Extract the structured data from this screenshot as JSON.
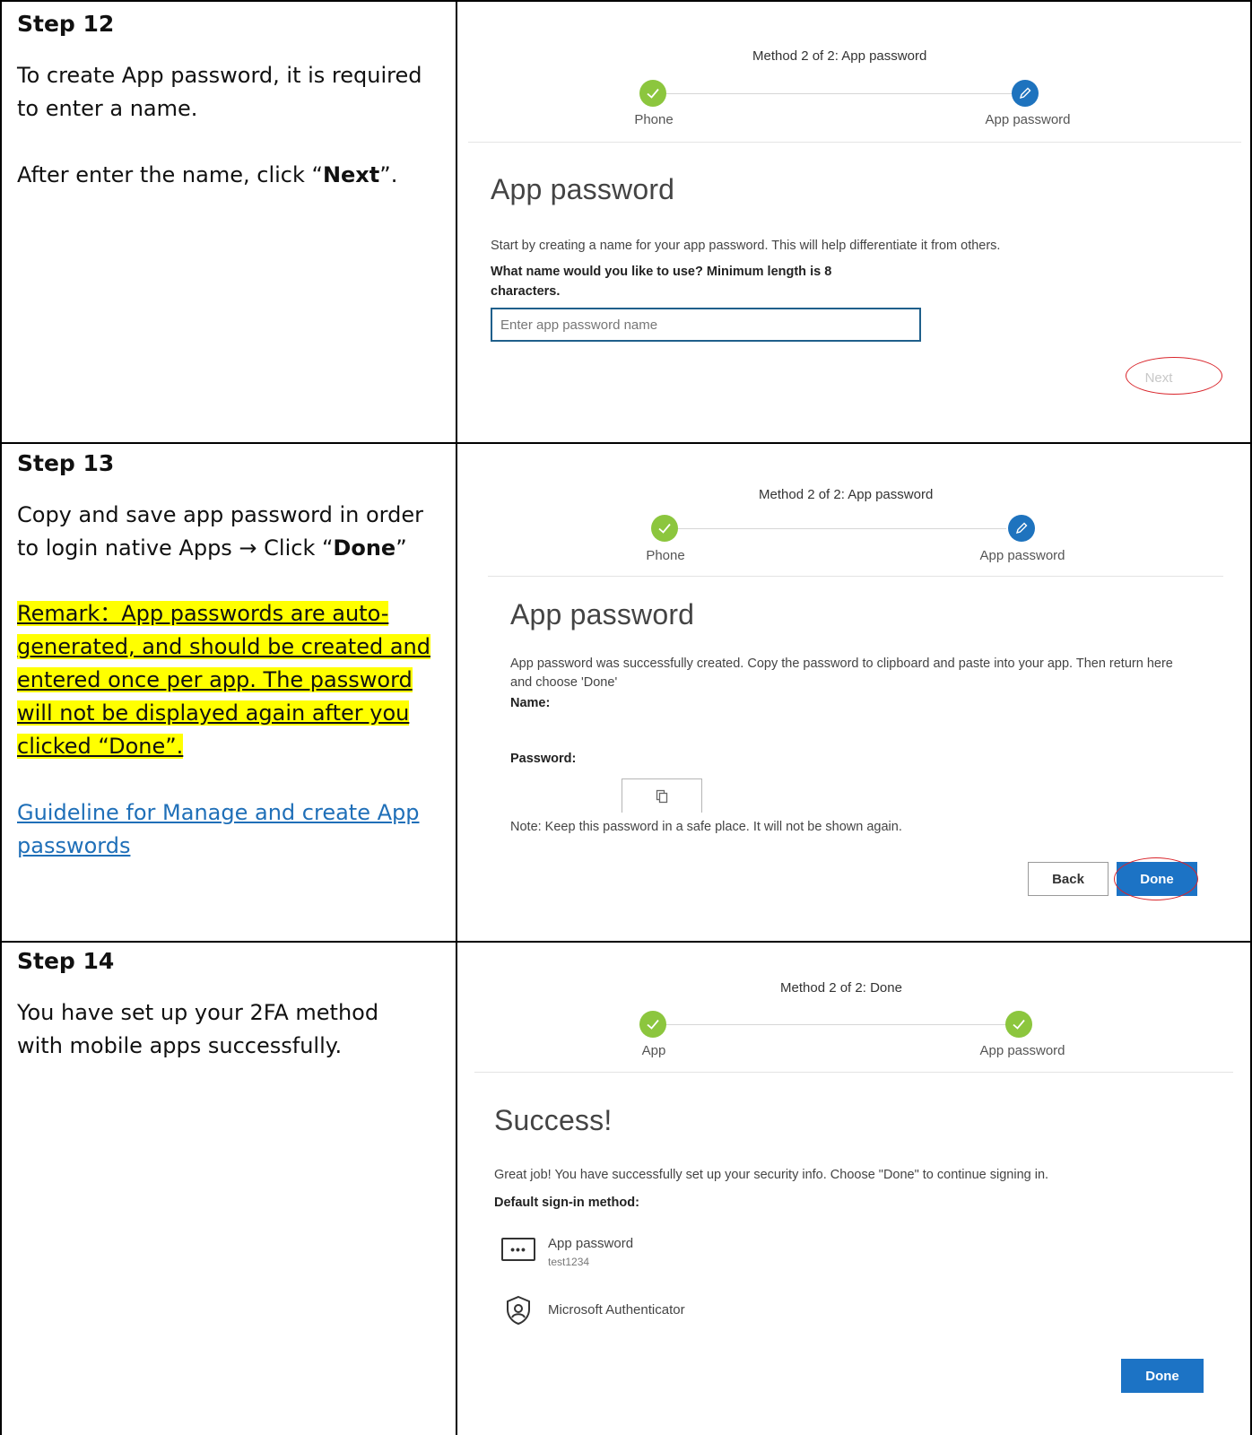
{
  "step12": {
    "title": "Step 12",
    "text1": "To create App password, it is required to enter a name.",
    "text2_prefix": "After enter the name, click “",
    "text2_bold": "Next",
    "text2_suffix": "”.",
    "screenshot": {
      "method_title": "Method 2 of 2: App password",
      "step1_label": "Phone",
      "step2_label": "App password",
      "heading": "App password",
      "description": "Start by creating a name for your app password. This will help differentiate it from others.",
      "question": "What name would you like to use? Minimum length is 8 characters.",
      "input_placeholder": "Enter app password name",
      "next_label": "Next"
    }
  },
  "step13": {
    "title": "Step 13",
    "text1_prefix": "Copy and save app password in order to login native Apps → Click “",
    "text1_bold": "Done",
    "text1_suffix": "”",
    "remark": "Remark：App passwords are auto-generated, and should be created and entered once per app. The password will not be displayed again after you clicked “Done”.",
    "link": "Guideline for Manage and create App passwords",
    "screenshot": {
      "method_title": "Method 2 of 2: App password",
      "step1_label": "Phone",
      "step2_label": "App password",
      "heading": "App password",
      "description": "App password was successfully created. Copy the password to clipboard and paste into your app. Then return here and choose 'Done'",
      "name_label": "Name:",
      "password_label": "Password:",
      "note": "Note: Keep this password in a safe place. It will not be shown again.",
      "back_label": "Back",
      "done_label": "Done"
    }
  },
  "step14": {
    "title": "Step 14",
    "text1": "You have set up your 2FA method with mobile apps successfully.",
    "screenshot": {
      "method_title": "Method 2 of 2: Done",
      "step1_label": "App",
      "step2_label": "App password",
      "heading": "Success!",
      "description": "Great job! You have successfully set up your security info. Choose \"Done\" to continue signing in.",
      "default_label": "Default sign-in method:",
      "method1_name": "App password",
      "method1_value": "test1234",
      "method2_name": "Microsoft Authenticator",
      "done_label": "Done"
    }
  },
  "colors": {
    "green_check": "#8cc63e",
    "blue_edit": "#1e73be",
    "primary_button": "#1c73c5",
    "highlight": "#ffff00",
    "annotation_red": "#d9252b",
    "link": "#1f6fb8"
  },
  "icons": {
    "check": "check-icon",
    "edit": "pencil-icon",
    "copy": "copy-icon",
    "password": "password-dots-icon",
    "authenticator": "authenticator-icon"
  }
}
